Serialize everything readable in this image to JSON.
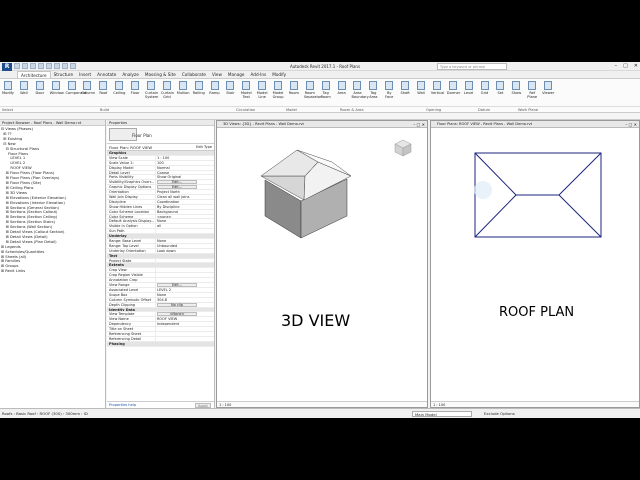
{
  "title": {
    "app": "Autodesk Revit 2017.1 - Roof Plans",
    "search_placeholder": "Type a keyword or phrase",
    "app_icon": "R"
  },
  "tabs": [
    "Architecture",
    "Structure",
    "Insert",
    "Annotate",
    "Analyze",
    "Massing & Site",
    "Collaborate",
    "View",
    "Manage",
    "Add-Ins",
    "Modify"
  ],
  "ribbon": {
    "buttons": [
      "Modify",
      "Wall",
      "Door",
      "Window",
      "Component",
      "Column",
      "Roof",
      "Ceiling",
      "Floor",
      "Curtain System",
      "Curtain Grid",
      "Mullion",
      "Railing",
      "Ramp",
      "Stair",
      "Model Text",
      "Model Line",
      "Model Group",
      "Room",
      "Room Separator",
      "Tag Room",
      "Area",
      "Area Boundary",
      "Tag Area",
      "By Face",
      "Shaft",
      "Wall",
      "Vertical",
      "Dormer",
      "Level",
      "Grid",
      "Set",
      "Show",
      "Ref Plane",
      "Viewer"
    ],
    "groups": [
      "Select",
      "Build",
      "Circulation",
      "Model",
      "Room & Area",
      "Opening",
      "Datum",
      "Work Plane"
    ]
  },
  "project_browser": {
    "title": "Project Browser - Roof Plans - Wall Demo.rvt",
    "items": [
      "⊟ Views (Phases)",
      "  ⊞ ??",
      "  ⊞ Existing",
      "  ⊟ New",
      "    ⊟ Structural Plans",
      "      Floor Plans",
      "        LEVEL 1",
      "        LEVEL 2",
      "        ROOF VIEW",
      "    ⊞ Floor Plans (Floor Plans)",
      "    ⊞ Floor Plans (Plan Overlays)",
      "    ⊞ Floor Plans (Site)",
      "    ⊞ Ceiling Plans",
      "    ⊞ 3D Views",
      "    ⊞ Elevations (Exterior Elevation)",
      "    ⊞ Elevations (Interior Elevation)",
      "    ⊞ Sections (General Section)",
      "    ⊞ Sections (Section Callout)",
      "    ⊞ Sections (Section Ceiling)",
      "    ⊞ Sections (Section Stairs)",
      "    ⊞ Sections (Wall Section)",
      "    ⊞ Detail Views (Callout Section)",
      "    ⊞ Detail Views (Detail)",
      "    ⊞ Detail Views (Plan Detail)",
      "⊞ Legends",
      "⊞ Schedules/Quantities",
      "⊞ Sheets (all)",
      "⊞ Families",
      "⊞ Groups",
      "⊞ Revit Links"
    ]
  },
  "properties": {
    "title": "Properties",
    "type_name": "Floor Plan",
    "filter": "Floor Plan: ROOF VIEW",
    "edit_type": "Edit Type",
    "rows": [
      {
        "k": "Graphics",
        "v": "",
        "sec": true
      },
      {
        "k": "View Scale",
        "v": "1 : 100"
      },
      {
        "k": "Scale Value 1:",
        "v": "100"
      },
      {
        "k": "Display Model",
        "v": "Normal"
      },
      {
        "k": "Detail Level",
        "v": "Coarse"
      },
      {
        "k": "Parts Visibility",
        "v": "Show Original"
      },
      {
        "k": "Visibility/Graphics Overr...",
        "v": "Edit...",
        "btn": true
      },
      {
        "k": "Graphic Display Options",
        "v": "Edit...",
        "btn": true
      },
      {
        "k": "Orientation",
        "v": "Project North"
      },
      {
        "k": "Wall Join Display",
        "v": "Clean all wall joins"
      },
      {
        "k": "Discipline",
        "v": "Coordination"
      },
      {
        "k": "Show Hidden Lines",
        "v": "By Discipline"
      },
      {
        "k": "Color Scheme Location",
        "v": "Background"
      },
      {
        "k": "Color Scheme",
        "v": "<none>"
      },
      {
        "k": "Default Analysis Display...",
        "v": "None"
      },
      {
        "k": "Visible In Option",
        "v": "all"
      },
      {
        "k": "Sun Path",
        "v": ""
      },
      {
        "k": "Underlay",
        "v": "",
        "sec": true
      },
      {
        "k": "Range: Base Level",
        "v": "None"
      },
      {
        "k": "Range: Top Level",
        "v": "Unbounded"
      },
      {
        "k": "Underlay Orientation",
        "v": "Look down"
      },
      {
        "k": "Text",
        "v": "",
        "sec": true
      },
      {
        "k": "Project State",
        "v": ""
      },
      {
        "k": "Extents",
        "v": "",
        "sec": true
      },
      {
        "k": "Crop View",
        "v": ""
      },
      {
        "k": "Crop Region Visible",
        "v": ""
      },
      {
        "k": "Annotation Crop",
        "v": ""
      },
      {
        "k": "View Range",
        "v": "Edit...",
        "btn": true
      },
      {
        "k": "Associated Level",
        "v": "LEVEL 2"
      },
      {
        "k": "Scope Box",
        "v": "None"
      },
      {
        "k": "Column Symbolic Offset",
        "v": "304.8"
      },
      {
        "k": "Depth Clipping",
        "v": "No clip",
        "btn": true
      },
      {
        "k": "Identity Data",
        "v": "",
        "sec": true
      },
      {
        "k": "View Template",
        "v": "<None>",
        "btn": true
      },
      {
        "k": "View Name",
        "v": "ROOF VIEW"
      },
      {
        "k": "Dependency",
        "v": "Independent"
      },
      {
        "k": "Title on Sheet",
        "v": ""
      },
      {
        "k": "Referencing Sheet",
        "v": ""
      },
      {
        "k": "Referencing Detail",
        "v": ""
      },
      {
        "k": "Phasing",
        "v": "",
        "sec": true
      }
    ],
    "help": "Properties help",
    "apply": "Apply"
  },
  "view3d": {
    "title": "3D Views: {3D} - Revit Plans - Wall Demo.rvt",
    "label": "3D VIEW",
    "scale": "1 : 100"
  },
  "roofplan": {
    "title": "Floor Plans: ROOF VIEW - Revit Plans - Wall Demo.rvt",
    "label": "ROOF PLAN",
    "scale": "1 : 100"
  },
  "statusbar": {
    "text": "Roofs : Basic Roof : ROOF (300) : 300mm : ID",
    "model": "Main Model",
    "exclude": "Exclude Options"
  }
}
